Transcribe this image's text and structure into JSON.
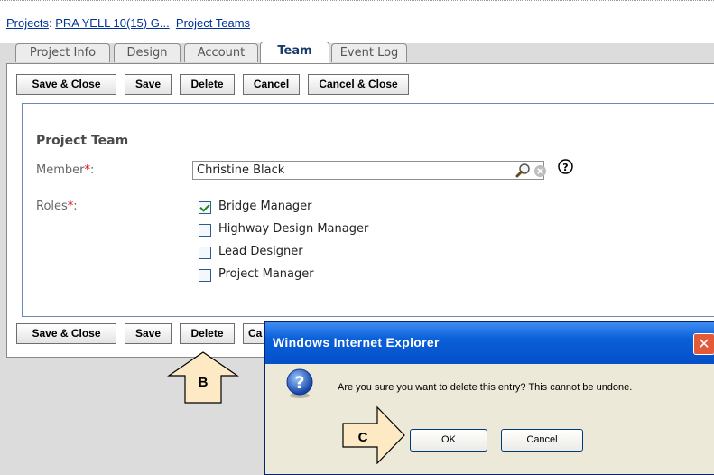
{
  "breadcrumb": {
    "projects_label": "Projects",
    "separator": ":",
    "project_name": "PRA YELL 10(15) G...",
    "section": "Project Teams"
  },
  "tabs": [
    {
      "label": "Project Info",
      "active": false
    },
    {
      "label": "Design",
      "active": false
    },
    {
      "label": "Account",
      "active": false
    },
    {
      "label": "Team",
      "active": true
    },
    {
      "label": "Event Log",
      "active": false
    }
  ],
  "toolbar": {
    "save_close": "Save & Close",
    "save": "Save",
    "delete": "Delete",
    "cancel": "Cancel",
    "cancel_close": "Cancel & Close"
  },
  "bottom_toolbar": {
    "save_close": "Save & Close",
    "save": "Save",
    "delete": "Delete",
    "cancel_partial": "Ca"
  },
  "form": {
    "section_title": "Project Team",
    "member_label": "Member",
    "roles_label": "Roles",
    "required_mark": "*",
    "label_suffix": ":",
    "member_value": "Christine Black",
    "roles": [
      {
        "label": "Bridge Manager",
        "checked": true
      },
      {
        "label": "Highway Design Manager",
        "checked": false
      },
      {
        "label": "Lead Designer",
        "checked": false
      },
      {
        "label": "Project Manager",
        "checked": false
      }
    ]
  },
  "dialog": {
    "title": "Windows Internet Explorer",
    "message": "Are you sure you want to delete this entry?  This cannot be undone.",
    "ok": "OK",
    "cancel": "Cancel",
    "close_glyph": "✕",
    "icon": "question-icon"
  },
  "callouts": {
    "b": "B",
    "c": "C"
  },
  "icons": [
    "search-icon",
    "clear-icon",
    "help-icon",
    "question-icon"
  ],
  "colors": {
    "link": "#003399",
    "dialog_title_bar": "#0a5fd8",
    "callout_fill": "#fde9c3",
    "required": "#e00000"
  }
}
